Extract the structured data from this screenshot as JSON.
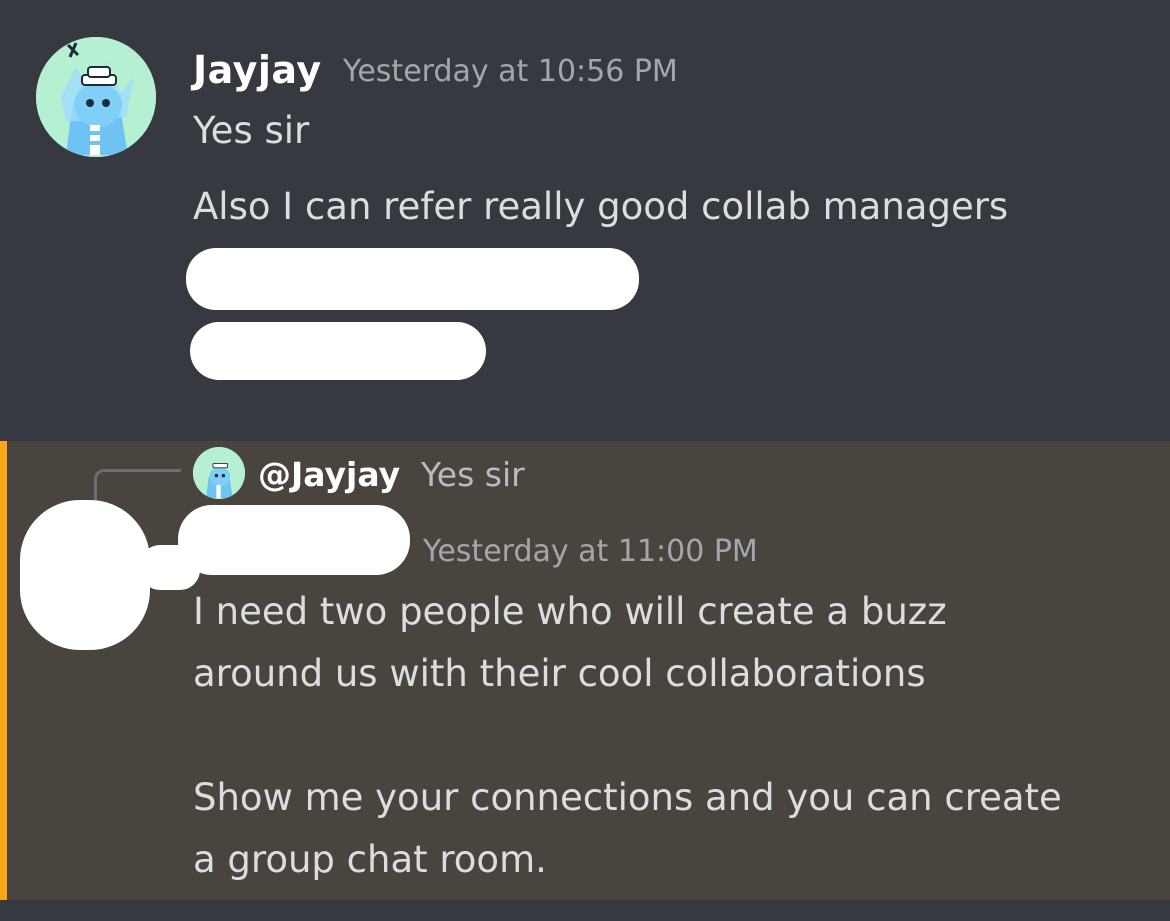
{
  "colors": {
    "background": "#36393f",
    "mention_background": "#4a443f",
    "mention_bar": "#faa61a",
    "username": "#ffffff",
    "timestamp": "#a3a6aa",
    "message_text": "#dcddde"
  },
  "messages": [
    {
      "author": "Jayjay",
      "timestamp": "Yesterday at 10:56 PM",
      "avatar_icon": "sailor-creature-avatar-icon",
      "lines": [
        "Yes sir",
        "Also I can refer really good collab managers"
      ]
    },
    {
      "author": "",
      "timestamp": "Yesterday at 11:00 PM",
      "avatar_icon": "redacted-avatar",
      "reply": {
        "mention": "@Jayjay",
        "text": "Yes sir",
        "avatar_icon": "sailor-creature-avatar-icon"
      },
      "text": "I need two people who will create a buzz\naround us with their cool collaborations\n\nShow me your connections and you can create\na group chat room."
    }
  ]
}
